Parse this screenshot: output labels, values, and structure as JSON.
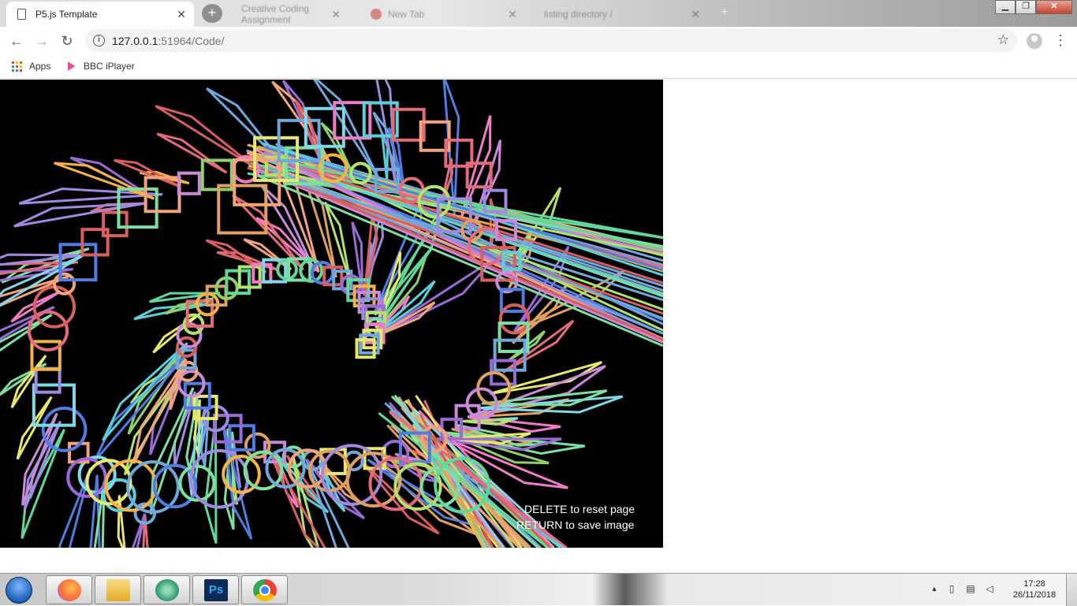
{
  "browser": {
    "tabs": [
      {
        "title": "P5.js Template",
        "active": true
      },
      {
        "title": "Creative Coding Assignment",
        "active": false
      },
      {
        "title": "New Tab",
        "active": false
      },
      {
        "title": "listing directory /",
        "active": false
      }
    ],
    "new_tab_symbol": "+",
    "window_controls": {
      "minimize": "▁",
      "maximize": "❐",
      "close": "✕"
    },
    "nav": {
      "back": "←",
      "forward": "→",
      "reload": "↻"
    },
    "url_host": "127.0.0.1",
    "url_rest": ":51964/Code/",
    "bookmark_star": "☆",
    "menu_dots": "⋮",
    "bookmarks": [
      {
        "label": "Apps",
        "icon": "apps-grid-icon"
      },
      {
        "label": "BBC iPlayer",
        "icon": "bbc-iplayer-icon"
      }
    ]
  },
  "canvas": {
    "hint_line1_key": "DELETE",
    "hint_line1_rest": " to reset page",
    "hint_line2_key": "RETURN",
    "hint_line2_rest": " to save image"
  },
  "taskbar": {
    "apps": [
      {
        "name": "Firefox",
        "icon": "firefox-icon",
        "color": "#ff7139"
      },
      {
        "name": "Windows Explorer",
        "icon": "folder-icon",
        "color": "#f3c24d"
      },
      {
        "name": "Atom",
        "icon": "atom-icon",
        "color": "#66595c"
      },
      {
        "name": "Photoshop",
        "icon": "photoshop-icon",
        "color": "#0f2a54"
      },
      {
        "name": "Chrome",
        "icon": "chrome-icon",
        "color": "#4285f4"
      }
    ],
    "tray_arrow": "▲",
    "time": "17:28",
    "date": "26/11/2018"
  }
}
